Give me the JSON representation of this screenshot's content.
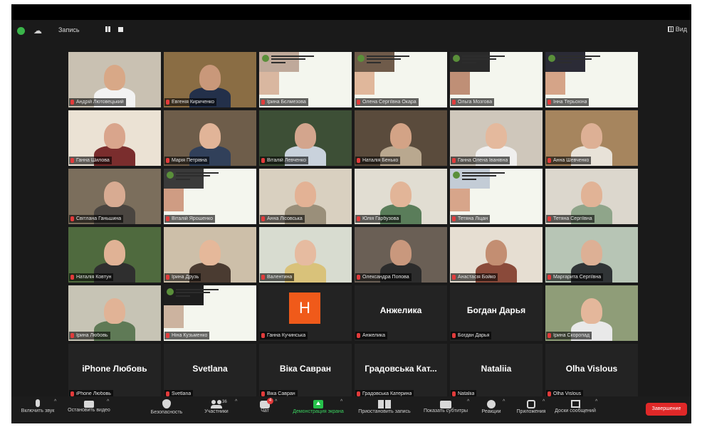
{
  "status": {
    "recording_label": "Запись",
    "view_label": "Вид"
  },
  "tiles": [
    {
      "name": "Андрій Лютовецький",
      "kind": "video",
      "bg": "#c9c1b2",
      "skin": "#d8a887",
      "shirt": "#f2f2f2"
    },
    {
      "name": "Евгенія Кириченко",
      "kind": "video",
      "bg": "#8a6d44",
      "skin": "#c9987a",
      "shirt": "#23304a",
      "active": true
    },
    {
      "name": "Ірина Бєлмезова",
      "kind": "slide",
      "skin": "#d9b7a0",
      "shirt": "#bfa99a"
    },
    {
      "name": "Олена Сергіївна Окара",
      "kind": "slide",
      "skin": "#e0b79b",
      "shirt": "#6f5b4a"
    },
    {
      "name": "Ольга Мозгова",
      "kind": "slide",
      "skin": "#bf8f76",
      "shirt": "#2a2a2a"
    },
    {
      "name": "Інна Терьохіна",
      "kind": "slide",
      "skin": "#d5a488",
      "shirt": "#2b2b36"
    },
    {
      "name": "Ганна Шилова",
      "kind": "video",
      "bg": "#ebe2d4",
      "skin": "#d9a58c",
      "shirt": "#7a2d2d"
    },
    {
      "name": "Марія Петрівна",
      "kind": "video",
      "bg": "#6e5d4a",
      "skin": "#e1b498",
      "shirt": "#31405a"
    },
    {
      "name": "Віталій Левченко",
      "kind": "video",
      "bg": "#3d4f36",
      "skin": "#d3a58d",
      "shirt": "#c9d2dc"
    },
    {
      "name": "Наталія Бенько",
      "kind": "video",
      "bg": "#5a4b3c",
      "skin": "#d3a386",
      "shirt": "#b9a88f"
    },
    {
      "name": "Ганна Олена Іванівна",
      "kind": "video",
      "bg": "#cfc7bb",
      "skin": "#e4b99d",
      "shirt": "#f0efee"
    },
    {
      "name": "Анна Шевченко",
      "kind": "video",
      "bg": "#a6855e",
      "skin": "#ddb095",
      "shirt": "#e8e2d8"
    },
    {
      "name": "Світлана Ганьшина",
      "kind": "video",
      "bg": "#7b6e5c",
      "skin": "#d8ab92",
      "shirt": "#4a4540"
    },
    {
      "name": "Віталій Ярошенко",
      "kind": "slide",
      "skin": "#cf9c83",
      "shirt": "#3a3a3a"
    },
    {
      "name": "Анна Лісовська",
      "kind": "video",
      "bg": "#d9d0c0",
      "skin": "#e3b295",
      "shirt": "#9a8f7a"
    },
    {
      "name": "Юлія Гарбузова",
      "kind": "video",
      "bg": "#e1ddd2",
      "skin": "#e2b598",
      "shirt": "#5a7d5a"
    },
    {
      "name": "Тетяна Ліцан",
      "kind": "slide",
      "skin": "#d7a58a",
      "shirt": "#c3ccd6"
    },
    {
      "name": "Тетяна Сергіївна",
      "kind": "video",
      "bg": "#dcd7cd",
      "skin": "#e1b396",
      "shirt": "#8fa58a"
    },
    {
      "name": "Наталія Ковтун",
      "kind": "video",
      "bg": "#4f6a3e",
      "skin": "#e0b295",
      "shirt": "#2f2f2f"
    },
    {
      "name": "Ірина Друзь",
      "kind": "video",
      "bg": "#cdbfa9",
      "skin": "#e5b89a",
      "shirt": "#4a3b31"
    },
    {
      "name": "Валентина",
      "kind": "video",
      "bg": "#d8dcd0",
      "skin": "#e6bba0",
      "shirt": "#d9c27a"
    },
    {
      "name": "Олександра Попова",
      "kind": "video",
      "bg": "#6a5f55",
      "skin": "#c9987d",
      "shirt": "#2c2c2c"
    },
    {
      "name": "Анастасія Бойко",
      "kind": "video",
      "bg": "#e6ded2",
      "skin": "#c38e72",
      "shirt": "#8a4a3a"
    },
    {
      "name": "Маргарита Сергіївна",
      "kind": "video",
      "bg": "#b7c5b5",
      "skin": "#ddb095",
      "shirt": "#303436"
    },
    {
      "name": "Ірина Любовь",
      "kind": "video",
      "bg": "#c7c4b5",
      "skin": "#e1b396",
      "shirt": "#5f7a56"
    },
    {
      "name": "Ніна Кузьменко",
      "kind": "slide",
      "skin": "#ccb39f",
      "shirt": "#1e1e1e"
    },
    {
      "name": "Ганна Кучинська",
      "kind": "avatar",
      "letter": "H"
    },
    {
      "name": "Анжелика",
      "kind": "name",
      "center": "Анжелика"
    },
    {
      "name": "Богдан Дарья",
      "kind": "name",
      "center": "Богдан Дарья"
    },
    {
      "name": "Ірина Скоропад",
      "kind": "video",
      "bg": "#8f9d78",
      "skin": "#e4b79b",
      "shirt": "#e9e9e9"
    },
    {
      "name": "iPhone Любовь",
      "kind": "name",
      "center": "iPhone Любовь"
    },
    {
      "name": "Svetlana",
      "kind": "name",
      "center": "Svetlana"
    },
    {
      "name": "Віка Савран",
      "kind": "name",
      "center": "Віка Савран"
    },
    {
      "name": "Градовська Катерина",
      "kind": "name",
      "center": "Градовська Кат..."
    },
    {
      "name": "Nataliia",
      "kind": "name",
      "center": "Nataliia"
    },
    {
      "name": "Olha Vislous",
      "kind": "name",
      "center": "Olha Vislous"
    }
  ],
  "toolbar": {
    "mic": "Включить звук",
    "video": "Остановить видео",
    "security": "Безопасность",
    "participants": "Участники",
    "participants_count": "36",
    "chat": "Чат",
    "chat_badge": "4",
    "share": "Демонстрация экрана",
    "record": "Приостановить запись",
    "captions": "Показать субтитры",
    "reactions": "Реакции",
    "apps": "Приложения",
    "whiteboard": "Доски сообщений",
    "end": "Завершение"
  }
}
